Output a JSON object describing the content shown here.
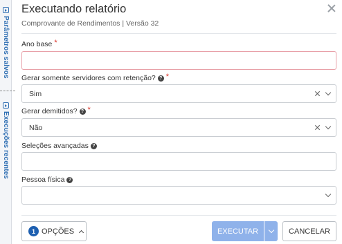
{
  "sidebar": {
    "tabs": [
      {
        "label": "Parâmetros salvos",
        "icon": "expand-panel-icon"
      },
      {
        "label": "Execuções recentes",
        "icon": "expand-panel-icon"
      }
    ]
  },
  "dialog": {
    "title": "Executando relatório",
    "subtitle": "Comprovante de Rendimentos | Versão 32",
    "close_icon": "close-icon"
  },
  "fields": {
    "ano_base": {
      "label": "Ano base",
      "required_mark": "*",
      "value": ""
    },
    "gerar_retencao": {
      "label": "Gerar somente servidores com retenção?",
      "required_mark": "*",
      "value": "Sim"
    },
    "gerar_demitidos": {
      "label": "Gerar demitidos?",
      "required_mark": "*",
      "value": "Não"
    },
    "selecoes_avancadas": {
      "label": "Seleções avançadas",
      "value": ""
    },
    "pessoa_fisica": {
      "label": "Pessoa física",
      "value": ""
    }
  },
  "footer": {
    "options_count": "1",
    "options_label": "OPÇÕES",
    "execute_label": "EXECUTAR",
    "cancel_label": "CANCELAR"
  },
  "colors": {
    "accent": "#1d5fb0",
    "execute_bg": "#8fb2ea",
    "required": "#d93025",
    "error_border": "#e8a0a8"
  }
}
